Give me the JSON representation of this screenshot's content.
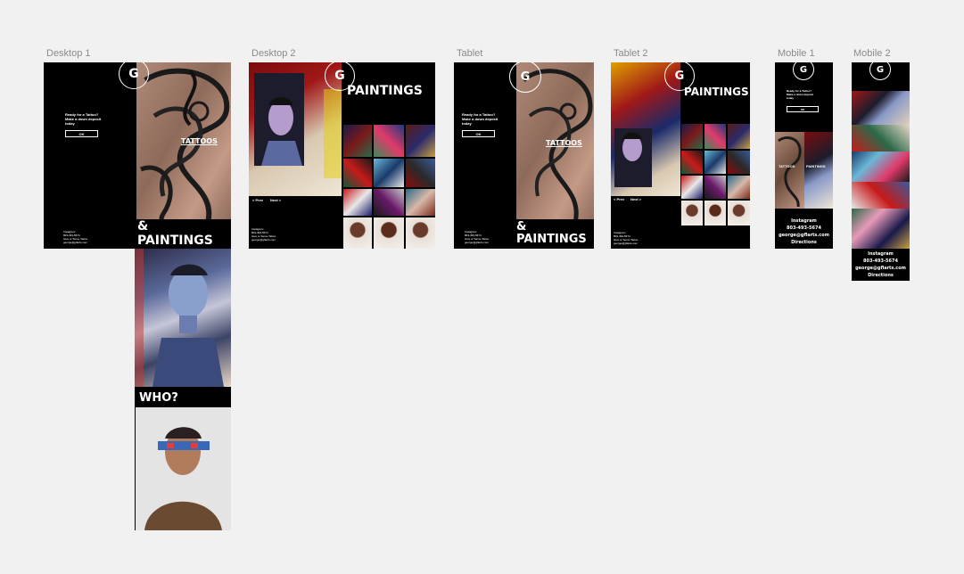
{
  "artboards": {
    "desktop1": "Desktop 1",
    "desktop2": "Desktop 2",
    "tablet": "Tablet",
    "tablet2": "Tablet 2",
    "mobile1": "Mobile 1",
    "mobile2": "Mobile 2"
  },
  "brand": {
    "logo_letter": "G"
  },
  "promo": {
    "line1": "Ready for a Tattoo?",
    "line2": "Make a down deposit",
    "line3": "today",
    "ok_label": "OK"
  },
  "sections": {
    "tattoos": "TATTOOS",
    "and_paintings": "& PAINTINGS",
    "paintings": "PAINTINGS",
    "who": "WHO?"
  },
  "gallery_nav": {
    "prev": "< Prev",
    "next": "Next >"
  },
  "contact": {
    "instagram": "Instagram",
    "phone": "803-493-5674",
    "address": "Give or Serve Tattoo",
    "email": "george@gflarts.com",
    "directions": "Directions"
  },
  "colors": {
    "canvas": "#f1f1f1",
    "artboard": "#000000",
    "label": "#8a8a8a",
    "text": "#ffffff"
  }
}
